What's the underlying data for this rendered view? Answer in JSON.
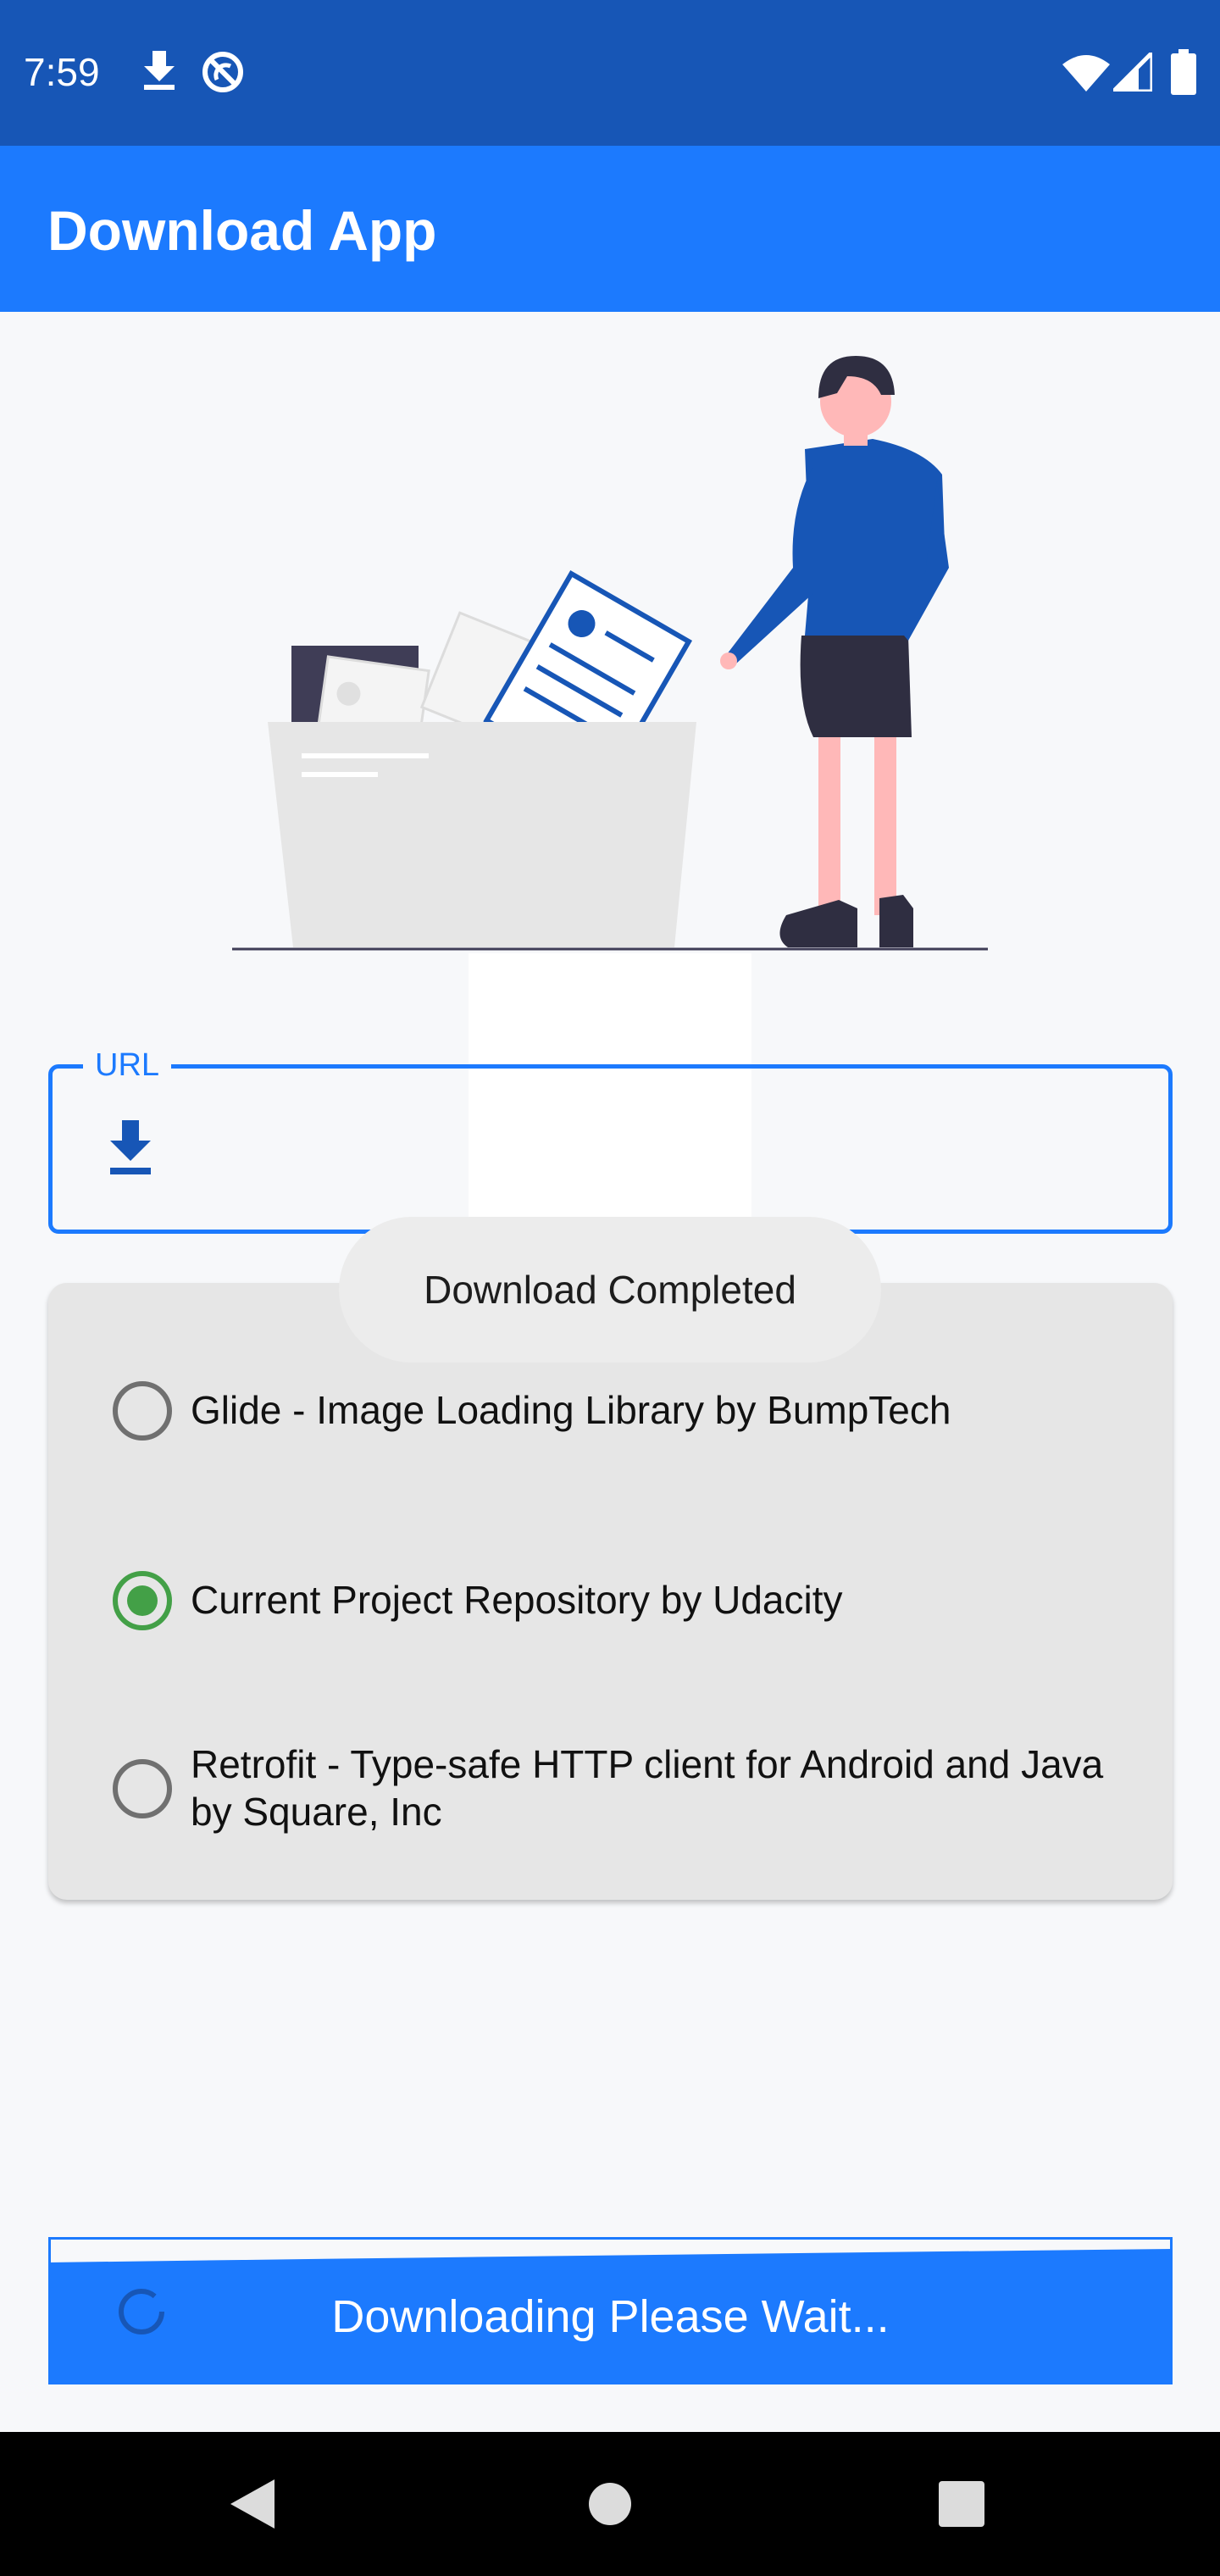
{
  "status_bar": {
    "time": "7:59",
    "icons_left": [
      "download-icon",
      "sync-disabled-icon"
    ],
    "icons_right": [
      "wifi-icon",
      "signal-icon",
      "battery-icon"
    ]
  },
  "app_bar": {
    "title": "Download App"
  },
  "url_field": {
    "label": "URL",
    "value": "",
    "icon": "download-icon",
    "accent_color": "#1c7afe"
  },
  "radio_group": {
    "options": [
      {
        "label": "Glide - Image Loading Library by BumpTech",
        "checked": false
      },
      {
        "label": "Current Project Repository by Udacity",
        "checked": true
      },
      {
        "label": "Retrofit - Type-safe HTTP client for Android and Java by Square, Inc",
        "checked": false
      }
    ],
    "checked_color": "#43a047"
  },
  "toast": {
    "message": "Download Completed"
  },
  "download_button": {
    "label": "Downloading Please Wait...",
    "color": "#1c7afe"
  },
  "nav_bar": {
    "buttons": [
      "back-icon",
      "home-icon",
      "recents-icon"
    ]
  }
}
